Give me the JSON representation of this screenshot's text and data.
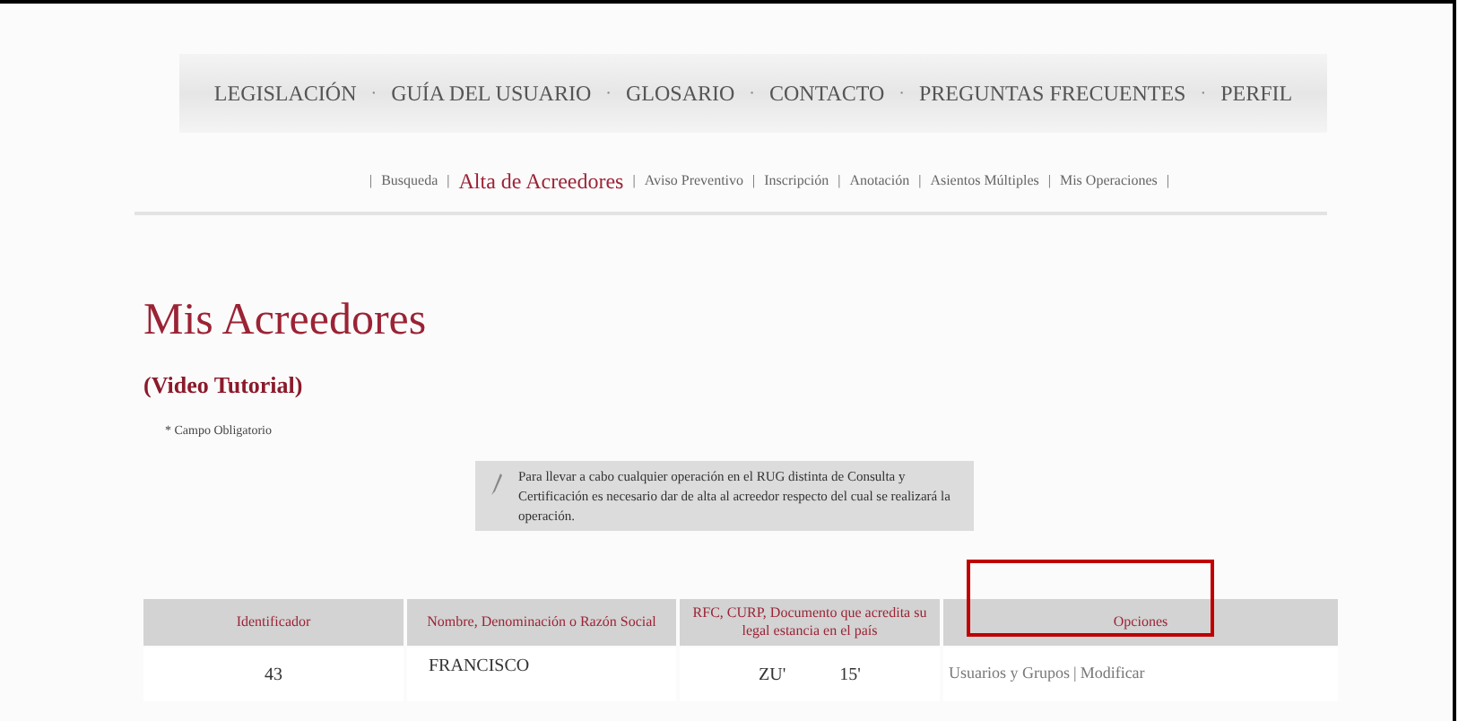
{
  "main_nav": [
    {
      "label": "LEGISLACIÓN"
    },
    {
      "label": "GUÍA DEL USUARIO"
    },
    {
      "label": "GLOSARIO"
    },
    {
      "label": "CONTACTO"
    },
    {
      "label": "PREGUNTAS FRECUENTES"
    },
    {
      "label": "PERFIL"
    }
  ],
  "nav_separator": "·",
  "sub_nav": [
    {
      "label": "Busqueda",
      "selected": false
    },
    {
      "label": "Alta de Acreedores",
      "selected": true
    },
    {
      "label": "Aviso Preventivo",
      "selected": false
    },
    {
      "label": "Inscripción",
      "selected": false
    },
    {
      "label": "Anotación",
      "selected": false
    },
    {
      "label": "Asientos Múltiples",
      "selected": false
    },
    {
      "label": "Mis Operaciones",
      "selected": false
    }
  ],
  "sub_separator": "|",
  "title": "Mis Acreedores",
  "video_link": "(Video Tutorial)",
  "required_note": "* Campo Obligatorio",
  "info_note": "Para llevar a cabo cualquier operación en el RUG distinta de Consulta y Certificación es necesario dar de alta al acreedor respecto del cual se realizará la operación.",
  "table": {
    "columns": [
      {
        "label": "Identificador",
        "highlighted": false
      },
      {
        "label": "Nombre, Denominación o Razón Social",
        "highlighted": false
      },
      {
        "label": "RFC, CURP, Documento que acredita su legal estancia en el país",
        "highlighted": false
      },
      {
        "label": "Opciones",
        "highlighted": true
      }
    ],
    "rows": [
      {
        "id": "43",
        "name": "FRANCISCO",
        "rfc": [
          "ZU'",
          "15'"
        ],
        "options": [
          "Usuarios y Grupos",
          "Modificar"
        ]
      }
    ]
  }
}
